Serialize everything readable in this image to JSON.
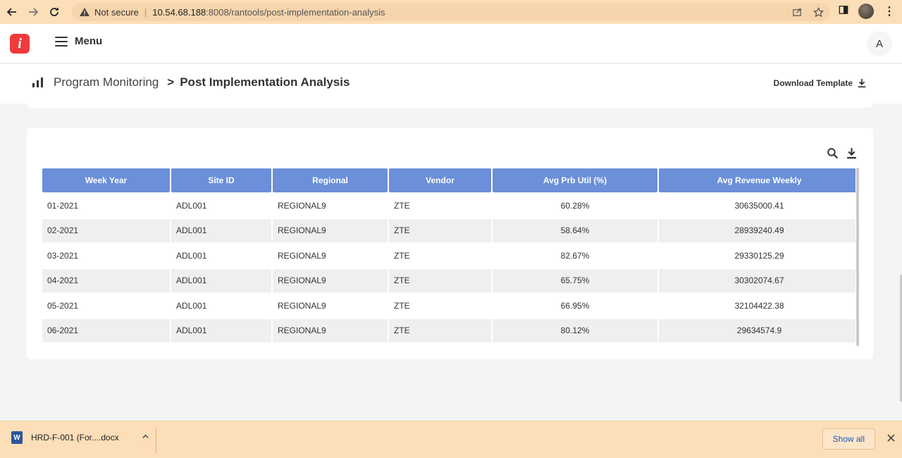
{
  "browser": {
    "security_label": "Not secure",
    "url_host": "10.54.68.188",
    "url_rest": ":8008/rantools/post-implementation-analysis"
  },
  "app": {
    "logo_letter": "i",
    "menu_label": "Menu",
    "avatar_initial": "A"
  },
  "breadcrumb": {
    "parent": "Program Monitoring",
    "separator": ">",
    "current": "Post Implementation Analysis",
    "download_template_label": "Download Template"
  },
  "table": {
    "columns": [
      "Week Year",
      "Site ID",
      "Regional",
      "Vendor",
      "Avg Prb Util (%)",
      "Avg Revenue Weekly"
    ],
    "rows": [
      [
        "01-2021",
        "ADL001",
        "REGIONAL9",
        "ZTE",
        "60.28%",
        "30635000.41"
      ],
      [
        "02-2021",
        "ADL001",
        "REGIONAL9",
        "ZTE",
        "58.64%",
        "28939240.49"
      ],
      [
        "03-2021",
        "ADL001",
        "REGIONAL9",
        "ZTE",
        "82.67%",
        "29330125.29"
      ],
      [
        "04-2021",
        "ADL001",
        "REGIONAL9",
        "ZTE",
        "65.75%",
        "30302074.67"
      ],
      [
        "05-2021",
        "ADL001",
        "REGIONAL9",
        "ZTE",
        "66.95%",
        "32104422.38"
      ],
      [
        "06-2021",
        "ADL001",
        "REGIONAL9",
        "ZTE",
        "80.12%",
        "29634574.9"
      ]
    ]
  },
  "downloads": {
    "file_name": "HRD-F-001 (For....docx",
    "file_icon_letter": "W",
    "show_all_label": "Show all"
  },
  "colors": {
    "header_accent": "#6b8fd9",
    "logo": "#ef3b3b",
    "chrome": "#fcdfb8"
  }
}
